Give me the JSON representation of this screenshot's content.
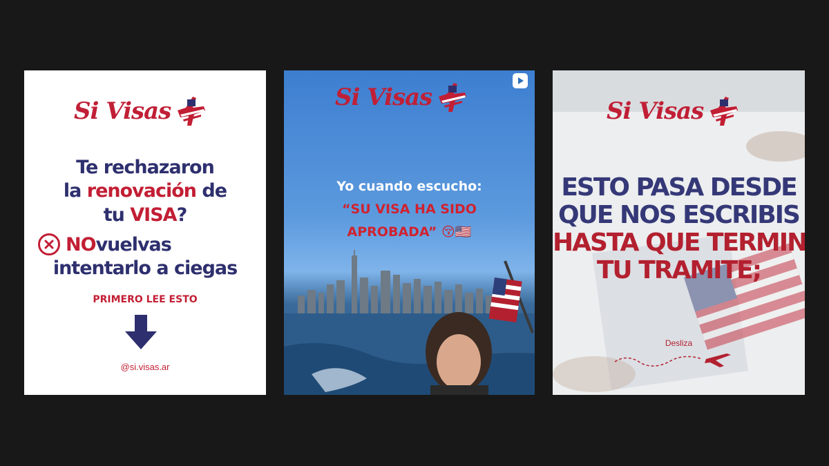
{
  "brand": {
    "logo_text": "Si Visas",
    "colors": {
      "red": "#c21e34",
      "navy": "#2e2f6e",
      "background": "#181818"
    }
  },
  "card1": {
    "line1": "Te rechazaron",
    "line2_pre": "la ",
    "line2_red": "renovación",
    "line2_post": " de",
    "line3_pre": "tu ",
    "line3_red": "VISA",
    "line3_post": "?",
    "line4_red": "NO",
    "line4_post": " vuelvas",
    "line5": "intentarlo a ciegas",
    "cta": "PRIMERO LEE ESTO",
    "handle": "@si.visas.ar",
    "icons": [
      "x-circle-icon",
      "down-arrow-icon"
    ]
  },
  "card2": {
    "line1": "Yo cuando escucho:",
    "line2": "“SU VISA HA SIDO",
    "line3": "APROBADA” 😚🇺🇸",
    "icons": [
      "play-icon"
    ]
  },
  "card3": {
    "line1": "ESTO PASA DESDE",
    "line2": "QUE NOS ESCRIBIS",
    "line3": "HASTA QUE TERMINA",
    "line4": "TU TRAMITE;",
    "swipe": "Desliza",
    "icons": [
      "airplane-icon"
    ]
  }
}
